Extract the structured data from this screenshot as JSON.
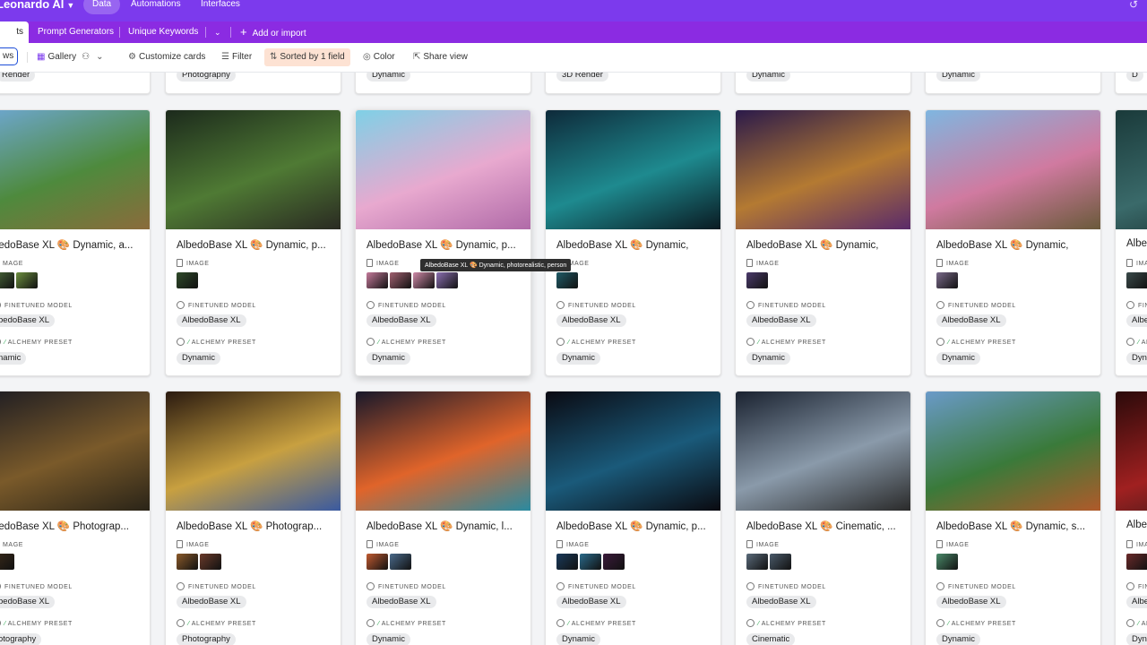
{
  "app": {
    "title": "Leonardo AI"
  },
  "topnav": [
    {
      "label": "Data",
      "active": true
    },
    {
      "label": "Automations",
      "active": false
    },
    {
      "label": "Interfaces",
      "active": false
    }
  ],
  "tabs": [
    {
      "label": "ts",
      "active": true
    },
    {
      "label": "Prompt Generators"
    },
    {
      "label": "Unique Keywords"
    }
  ],
  "add_import_label": "Add or import",
  "toolbar": {
    "views_label": "ws",
    "gallery_label": "Gallery",
    "customize_label": "Customize cards",
    "filter_label": "Filter",
    "sorted_label": "Sorted by 1 field",
    "color_label": "Color",
    "share_label": "Share view"
  },
  "field_labels": {
    "image_full": "IMAGE",
    "image_cut": "MAGE",
    "model": "FINETUNED MODEL",
    "preset": "ALCHEMY PRESET"
  },
  "top_row_tags": [
    "Render",
    "Photography",
    "Dynamic",
    "3D Render",
    "Dynamic",
    "Dynamic",
    "D"
  ],
  "rows": [
    [
      {
        "title": "bedoBase XL 🎨 Dynamic, a...",
        "model": "bedoBase XL",
        "preset": "namic",
        "thumbs": [
          "#4b6b3a",
          "#6c8f3e"
        ],
        "cover": [
          "#6fa8d6",
          "#4e8a3d",
          "#8b6b3c"
        ]
      },
      {
        "title": "AlbedoBase XL 🎨 Dynamic, p...",
        "model": "AlbedoBase XL",
        "preset": "Dynamic",
        "thumbs": [
          "#2f4a2a"
        ],
        "cover": [
          "#1c2a1c",
          "#4f7a34",
          "#2a2a22"
        ]
      },
      {
        "title": "AlbedoBase XL 🎨 Dynamic, p...",
        "model": "AlbedoBase XL",
        "preset": "Dynamic",
        "thumbs": [
          "#c47a9a",
          "#a06070",
          "#d08aa8",
          "#8a6fb0"
        ],
        "cover": [
          "#7fd0e6",
          "#e8a9cf",
          "#b06aa8"
        ]
      },
      {
        "title": "AlbedoBase XL 🎨 Dynamic,",
        "model": "AlbedoBase XL",
        "preset": "Dynamic",
        "thumbs": [
          "#1f5a66"
        ],
        "cover": [
          "#0e2a3a",
          "#1e8a8f",
          "#0a1a22"
        ]
      },
      {
        "title": "AlbedoBase XL 🎨 Dynamic,",
        "model": "AlbedoBase XL",
        "preset": "Dynamic",
        "thumbs": [
          "#4a3a6a"
        ],
        "cover": [
          "#2b1a4a",
          "#b47a32",
          "#5a2a6a"
        ]
      },
      {
        "title": "AlbedoBase XL 🎨 Dynamic,",
        "model": "AlbedoBase XL",
        "preset": "Dynamic",
        "thumbs": [
          "#7a6a8a"
        ],
        "cover": [
          "#7fb6e0",
          "#d07aa0",
          "#6a5a3a"
        ]
      },
      {
        "title": "Albe",
        "model": "Albe",
        "preset": "Dyn",
        "thumbs": [
          "#3a4a4a"
        ],
        "cover": [
          "#1a3a3a",
          "#3a6a6a",
          "#102020"
        ]
      }
    ],
    [
      {
        "title": "bedoBase XL 🎨 Photograp...",
        "model": "bedoBase XL",
        "preset": "otography",
        "thumbs": [
          "#3a2a1a"
        ],
        "cover": [
          "#1a1a22",
          "#7a5a2a",
          "#2a2418"
        ]
      },
      {
        "title": "AlbedoBase XL 🎨 Photograp...",
        "model": "AlbedoBase XL",
        "preset": "Photography",
        "thumbs": [
          "#8a5a2a",
          "#6a3a2a"
        ],
        "cover": [
          "#2a1a10",
          "#c8a040",
          "#3a5aa0"
        ]
      },
      {
        "title": "AlbedoBase XL 🎨 Dynamic, l...",
        "model": "AlbedoBase XL",
        "preset": "Dynamic",
        "thumbs": [
          "#c05a30",
          "#4a6a8a"
        ],
        "cover": [
          "#18182a",
          "#e0642a",
          "#2a8aa0"
        ]
      },
      {
        "title": "AlbedoBase XL 🎨 Dynamic, p...",
        "model": "AlbedoBase XL",
        "preset": "Dynamic",
        "thumbs": [
          "#1a3a5a",
          "#2a6a8a",
          "#3a1a3a"
        ],
        "cover": [
          "#0a0a12",
          "#1a5a7a",
          "#0a0a10"
        ]
      },
      {
        "title": "AlbedoBase XL 🎨 Cinematic, ...",
        "model": "AlbedoBase XL",
        "preset": "Cinematic",
        "thumbs": [
          "#5a6a7a",
          "#4a5a6a"
        ],
        "cover": [
          "#1a2230",
          "#8a9aaa",
          "#2a2a2a"
        ]
      },
      {
        "title": "AlbedoBase XL 🎨 Dynamic, s...",
        "model": "AlbedoBase XL",
        "preset": "Dynamic",
        "thumbs": [
          "#4a8a6a"
        ],
        "cover": [
          "#6a9ac8",
          "#3a7a3a",
          "#b05a2a"
        ]
      },
      {
        "title": "Albe",
        "model": "Albe",
        "preset": "Dyn",
        "thumbs": [
          "#6a2a2a"
        ],
        "cover": [
          "#2a0a0a",
          "#a02020",
          "#1a1a1a"
        ]
      }
    ]
  ],
  "tooltip": "AlbedoBase XL 🎨 Dynamic, photorealistic, person"
}
